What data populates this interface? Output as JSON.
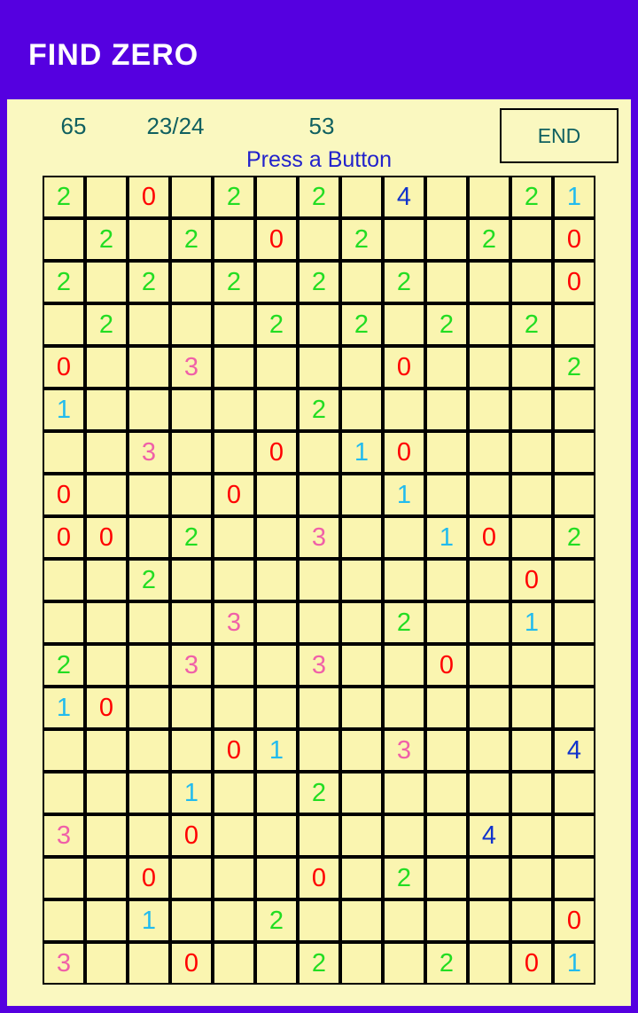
{
  "app": {
    "title": "FIND ZERO",
    "bar_color": "#5500e0",
    "panel_color": "#faf8c0"
  },
  "status": {
    "score": "65",
    "level": "23/24",
    "time": "53",
    "end_label": "END",
    "message": "Press a Button",
    "stat_color": "#106060",
    "message_color": "#2222cc"
  },
  "board": {
    "rows": 19,
    "cols": 13,
    "cell_color": "#faf5b0",
    "digit_colors": {
      "0": "#ff0000",
      "1": "#22bbee",
      "2": "#22dd22",
      "3": "#f060a8",
      "4": "#1133cc"
    },
    "cells": [
      [
        "2",
        "",
        "0",
        "",
        "2",
        "",
        "2",
        "",
        "4",
        "",
        "",
        "2",
        "1"
      ],
      [
        "",
        "2",
        "",
        "2",
        "",
        "0",
        "",
        "2",
        "",
        "",
        "2",
        "",
        "0"
      ],
      [
        "2",
        "",
        "2",
        "",
        "2",
        "",
        "2",
        "",
        "2",
        "",
        "",
        "",
        "0"
      ],
      [
        "",
        "2",
        "",
        "",
        "",
        "2",
        "",
        "2",
        "",
        "2",
        "",
        "2",
        ""
      ],
      [
        "0",
        "",
        "",
        "3",
        "",
        "",
        "",
        "",
        "0",
        "",
        "",
        "",
        "2"
      ],
      [
        "1",
        "",
        "",
        "",
        "",
        "",
        "2",
        "",
        "",
        "",
        "",
        "",
        ""
      ],
      [
        "",
        "",
        "3",
        "",
        "",
        "0",
        "",
        "1",
        "0",
        "",
        "",
        "",
        ""
      ],
      [
        "0",
        "",
        "",
        "",
        "0",
        "",
        "",
        "",
        "1",
        "",
        "",
        "",
        ""
      ],
      [
        "0",
        "0",
        "",
        "2",
        "",
        "",
        "3",
        "",
        "",
        "1",
        "0",
        "",
        "2"
      ],
      [
        "",
        "",
        "2",
        "",
        "",
        "",
        "",
        "",
        "",
        "",
        "",
        "0",
        ""
      ],
      [
        "",
        "",
        "",
        "",
        "3",
        "",
        "",
        "",
        "2",
        "",
        "",
        "1",
        ""
      ],
      [
        "2",
        "",
        "",
        "3",
        "",
        "",
        "3",
        "",
        "",
        "0",
        "",
        "",
        ""
      ],
      [
        "1",
        "0",
        "",
        "",
        "",
        "",
        "",
        "",
        "",
        "",
        "",
        "",
        ""
      ],
      [
        "",
        "",
        "",
        "",
        "0",
        "1",
        "",
        "",
        "3",
        "",
        "",
        "",
        "4"
      ],
      [
        "",
        "",
        "",
        "1",
        "",
        "",
        "2",
        "",
        "",
        "",
        "",
        "",
        ""
      ],
      [
        "3",
        "",
        "",
        "0",
        "",
        "",
        "",
        "",
        "",
        "",
        "4",
        "",
        ""
      ],
      [
        "",
        "",
        "0",
        "",
        "",
        "",
        "0",
        "",
        "2",
        "",
        "",
        "",
        ""
      ],
      [
        "",
        "",
        "1",
        "",
        "",
        "2",
        "",
        "",
        "",
        "",
        "",
        "",
        "0"
      ],
      [
        "3",
        "",
        "",
        "0",
        "",
        "",
        "2",
        "",
        "",
        "2",
        "",
        "0",
        "1"
      ]
    ]
  }
}
